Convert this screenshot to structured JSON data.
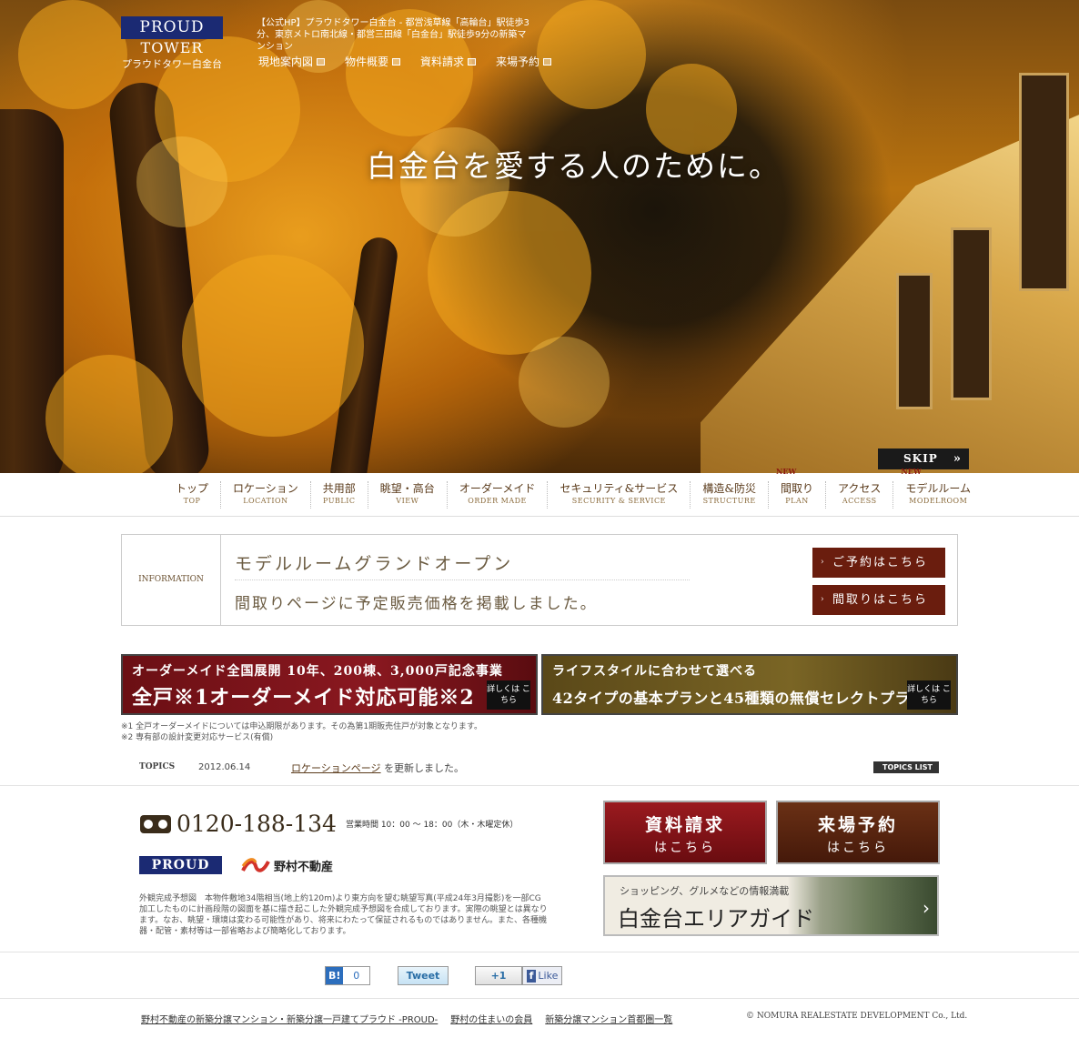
{
  "header": {
    "logo_main": "PROUD",
    "logo_sub1": "TOWER",
    "logo_sub2": "プラウドタワー白金台",
    "description": "【公式HP】プラウドタワー白金台 - 都営浅草線「高輪台」駅徒歩3分、東京メトロ南北線・都営三田線「白金台」駅徒歩9分の新築マンション",
    "links": [
      "現地案内図",
      "物件概要",
      "資料請求",
      "来場予約"
    ],
    "hero_title": "白金台を愛する人のために。",
    "skip_label": "SKIP"
  },
  "nav": [
    {
      "jp": "トップ",
      "en": "TOP",
      "new": ""
    },
    {
      "jp": "ロケーション",
      "en": "LOCATION",
      "new": ""
    },
    {
      "jp": "共用部",
      "en": "PUBLIC",
      "new": ""
    },
    {
      "jp": "眺望・高台",
      "en": "VIEW",
      "new": ""
    },
    {
      "jp": "オーダーメイド",
      "en": "ORDER MADE",
      "new": ""
    },
    {
      "jp": "セキュリティ&サービス",
      "en": "SECURITY & SERVICE",
      "new": ""
    },
    {
      "jp": "構造&防災",
      "en": "STRUCTURE",
      "new": ""
    },
    {
      "jp": "間取り",
      "en": "PLAN",
      "new": "NEW"
    },
    {
      "jp": "アクセス",
      "en": "ACCESS",
      "new": ""
    },
    {
      "jp": "モデルルーム",
      "en": "MODELROOM",
      "new": "NEW"
    }
  ],
  "info": {
    "label": "INFORMATION",
    "line1": "モデルルームグランドオープン",
    "line2": "間取りページに予定販売価格を掲載しました。",
    "btn_reserve": "ご予約はこちら",
    "btn_plan": "間取りはこちら"
  },
  "banners": {
    "b1_top": "オーダーメイド全国展開 10年、200棟、3,000戸記念事業",
    "b1_main": "全戸※1オーダーメイド対応可能※2",
    "b2_top": "ライフスタイルに合わせて選べる",
    "b2_main": "42タイプの基本プランと45種類の無償セレクトプラン",
    "more": "詳しくは こちら"
  },
  "notes": [
    "※1 全戸オーダーメイドについては申込期限があります。その為第1期販売住戸が対象となります。",
    "※2 専有部の設計変更対応サービス(有償)"
  ],
  "topics": {
    "label": "TOPICS",
    "date": "2012.06.14",
    "link_text": "ロケーションページ",
    "text": "を更新しました。",
    "list_label": "TOPICS LIST"
  },
  "contact": {
    "phone": "0120-188-134",
    "hours": "営業時間 10：00 〜 18：00（木・木曜定休）",
    "proud_logo": "PROUD",
    "nomura": "野村不動産",
    "disclaimer": "外観完成予想図　本物件敷地34階相当(地上約120m)より東方向を望む眺望写真(平成24年3月撮影)を一部CG加工したものに計画段階の図面を基に描き起こした外観完成予想図を合成しております。実際の眺望とは異なります。なお、眺望・環境は変わる可能性があり、将来にわたって保証されるものではありません。また、各種機器・配管・素材等は一部省略および簡略化しております。"
  },
  "cta": {
    "request_l1": "資料請求",
    "request_l2": "はこちら",
    "visit_l1": "来場予約",
    "visit_l2": "はこちら",
    "area_small": "ショッピング、グルメなどの情報満載",
    "area_big": "白金台エリアガイド"
  },
  "social": {
    "hatena_b": "B!",
    "hatena_count": "0",
    "tweet": "Tweet",
    "gplus": "+1",
    "like": "Like"
  },
  "footer": {
    "links": [
      "野村不動産の新築分譲マンション・新築分譲一戸建てプラウド -PROUD-",
      "野村の住まいの会員",
      "新築分譲マンション首都圏一覧"
    ],
    "copyright": "© NOMURA REALESTATE DEVELOPMENT Co., Ltd."
  }
}
